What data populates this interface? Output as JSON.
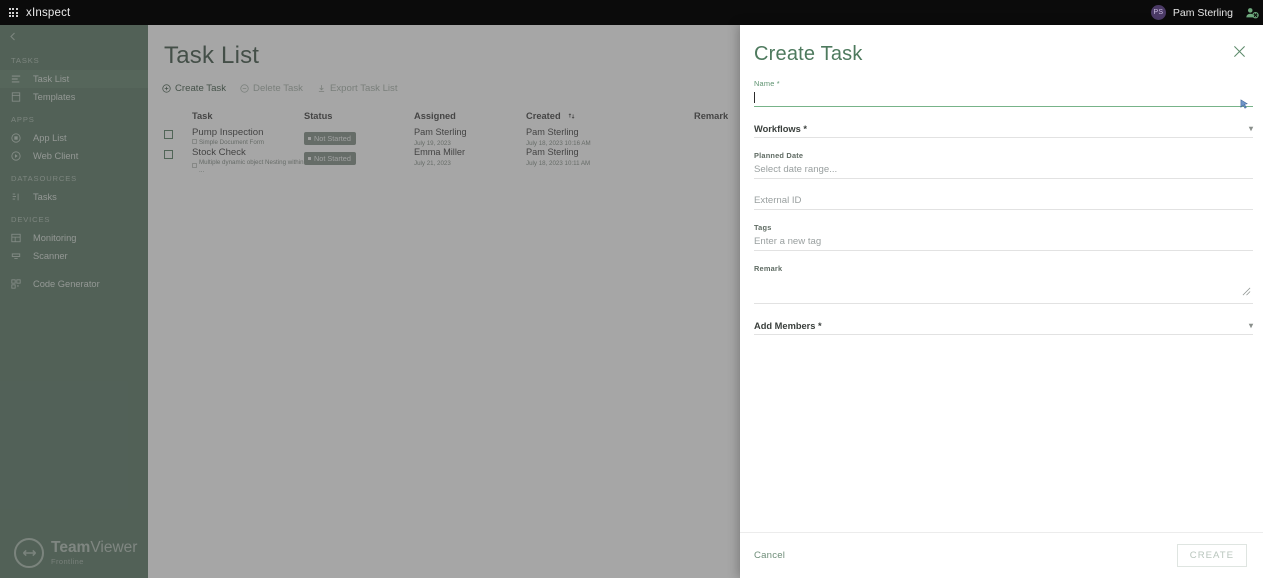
{
  "topbar": {
    "app_name": "xInspect",
    "waffle_icon": "apps-grid-icon",
    "user_initials": "PS",
    "user_name": "Pam Sterling",
    "user_icon": "user-settings-icon"
  },
  "sidebar": {
    "collapse_icon": "chevron-left-icon",
    "logo": {
      "brand": "Team",
      "brand2": "Viewer",
      "sub": "Frontline",
      "icon": "teamviewer-logo-icon"
    },
    "groups": [
      {
        "title": "TASKS",
        "items": [
          {
            "label": "Task List",
            "icon": "list-icon",
            "active": true
          },
          {
            "label": "Templates",
            "icon": "template-icon",
            "active": false
          }
        ]
      },
      {
        "title": "APPS",
        "items": [
          {
            "label": "App List",
            "icon": "app-grid-icon",
            "active": false
          },
          {
            "label": "Web Client",
            "icon": "play-circle-icon",
            "active": false
          }
        ]
      },
      {
        "title": "DATASOURCES",
        "items": [
          {
            "label": "Tasks",
            "icon": "datasource-icon",
            "active": false
          }
        ]
      },
      {
        "title": "DEVICES",
        "items": [
          {
            "label": "Monitoring",
            "icon": "monitor-icon",
            "active": false
          },
          {
            "label": "Scanner",
            "icon": "scanner-icon",
            "active": false
          }
        ]
      },
      {
        "title": "",
        "items": [
          {
            "label": "Code Generator",
            "icon": "qr-code-icon",
            "active": false
          }
        ]
      }
    ]
  },
  "main": {
    "title": "Task List",
    "toolbar": [
      {
        "label": "Create Task",
        "icon": "plus-circle-icon",
        "disabled": false
      },
      {
        "label": "Delete Task",
        "icon": "minus-circle-icon",
        "disabled": true
      },
      {
        "label": "Export Task List",
        "icon": "download-icon",
        "disabled": true
      }
    ],
    "table": {
      "headers": {
        "task": "Task",
        "status": "Status",
        "assigned": "Assigned",
        "created": "Created",
        "remark": "Remark",
        "sort_icon": "sort-arrows-icon"
      },
      "rows": [
        {
          "name": "Pump Inspection",
          "subtitle": "Simple Document Form",
          "subtitle_icon": "document-icon",
          "status": "Not Started",
          "assigned_name": "Pam Sterling",
          "assigned_date": "July 19, 2023",
          "created_name": "Pam Sterling",
          "created_date": "July 18, 2023 10:16 AM",
          "remark": ""
        },
        {
          "name": "Stock Check",
          "subtitle": "Multiple dynamic object Nesting within ...",
          "subtitle_icon": "document-icon",
          "status": "Not Started",
          "assigned_name": "Emma Miller",
          "assigned_date": "July 21, 2023",
          "created_name": "Pam Sterling",
          "created_date": "July 18, 2023 10:11 AM",
          "remark": ""
        }
      ]
    }
  },
  "drawer": {
    "title": "Create Task",
    "close_icon": "close-icon",
    "fields": {
      "name": {
        "label": "Name *",
        "value": "",
        "cursor_icon": "cursor-icon"
      },
      "workflows": {
        "label": "Workflows *",
        "value": "",
        "chevron_icon": "chevron-down-icon"
      },
      "planned_date": {
        "label": "Planned Date",
        "placeholder": "Select date range..."
      },
      "external_id": {
        "label": "",
        "placeholder": "External ID"
      },
      "tags": {
        "label": "Tags",
        "placeholder": "Enter a new tag"
      },
      "remark": {
        "label": "Remark",
        "placeholder": "",
        "resize_icon": "resize-handle-icon"
      },
      "add_members": {
        "label": "Add Members *",
        "value": "",
        "chevron_icon": "chevron-down-icon"
      }
    },
    "footer": {
      "cancel_label": "Cancel",
      "create_label": "CREATE",
      "create_disabled": true
    }
  },
  "colors": {
    "sidebar_bg": "#41624d",
    "accent_green": "#5e9370",
    "title_green": "#4e7a5e",
    "topbar_bg": "#0b0b0b",
    "badge_bg": "#6d7d73"
  }
}
